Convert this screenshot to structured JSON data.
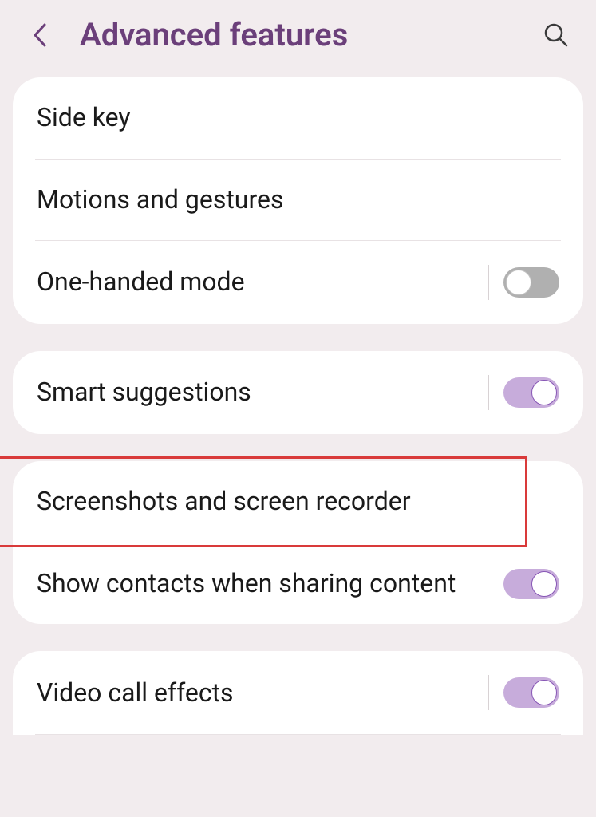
{
  "header": {
    "title": "Advanced features"
  },
  "sections": {
    "group1": {
      "side_key": "Side key",
      "motions_gestures": "Motions and gestures",
      "one_handed": "One-handed mode"
    },
    "group2": {
      "smart_suggestions": "Smart suggestions"
    },
    "group3": {
      "screenshots_recorder": "Screenshots and screen recorder",
      "show_contacts": "Show contacts when sharing content"
    },
    "group4": {
      "video_call_effects": "Video call effects"
    }
  },
  "toggles": {
    "one_handed": false,
    "smart_suggestions": true,
    "show_contacts": true,
    "video_call_effects": true
  }
}
